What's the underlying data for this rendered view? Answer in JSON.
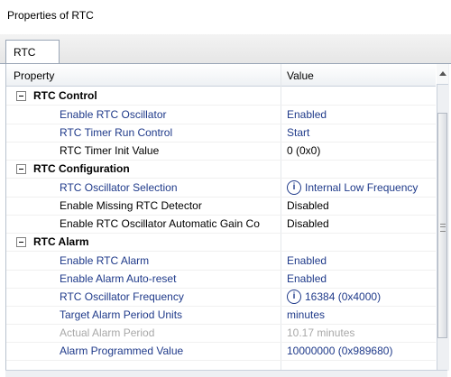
{
  "window": {
    "title": "Properties of RTC"
  },
  "tabs": [
    {
      "label": "RTC"
    }
  ],
  "grid": {
    "headers": {
      "property": "Property",
      "value": "Value"
    },
    "categories": [
      {
        "label": "RTC Control",
        "rows": [
          {
            "name": "Enable RTC Oscillator",
            "value": "Enabled"
          },
          {
            "name": "RTC Timer Run Control",
            "value": "Start"
          },
          {
            "name": "RTC Timer Init Value",
            "value": "0 (0x0)"
          }
        ]
      },
      {
        "label": "RTC Configuration",
        "rows": [
          {
            "name": "RTC Oscillator Selection",
            "value": "Internal Low Frequency",
            "icon": "info-icon"
          },
          {
            "name": "Enable Missing RTC Detector",
            "value": "Disabled"
          },
          {
            "name": "Enable RTC Oscillator Automatic Gain Co",
            "value": "Disabled"
          }
        ]
      },
      {
        "label": "RTC Alarm",
        "rows": [
          {
            "name": "Enable RTC Alarm",
            "value": "Enabled"
          },
          {
            "name": "Enable Alarm Auto-reset",
            "value": "Enabled"
          },
          {
            "name": "RTC Oscillator Frequency",
            "value": "16384 (0x4000)",
            "icon": "info-icon"
          },
          {
            "name": "Target Alarm Period Units",
            "value": "minutes"
          },
          {
            "name": "Actual Alarm Period",
            "value": "10.17 minutes"
          },
          {
            "name": "Alarm Programmed Value",
            "value": "10000000 (0x989680)"
          }
        ]
      }
    ]
  },
  "icons": {
    "collapse": "minus-box-icon",
    "info": "info-icon",
    "scroll_up": "arrow-up-icon"
  },
  "colors": {
    "link_text": "#1f3a8a",
    "disabled_text": "#a8a8a8"
  }
}
